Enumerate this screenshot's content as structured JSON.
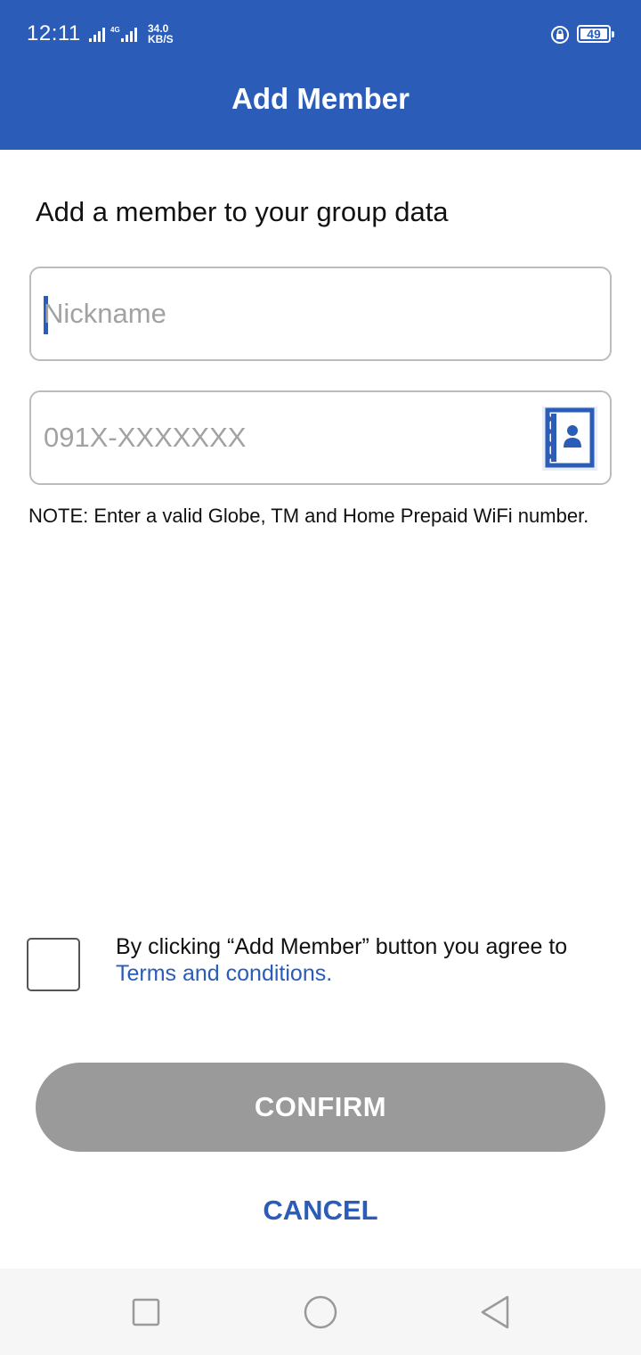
{
  "status_bar": {
    "time": "12:11",
    "network": "4G",
    "speed_value": "34.0",
    "speed_unit": "KB/S",
    "battery": "49"
  },
  "header": {
    "title": "Add Member",
    "background_color": "#2a5cb8"
  },
  "subtitle": "Add a member to your group data",
  "nickname_field": {
    "placeholder": "Nickname",
    "value": ""
  },
  "phone_field": {
    "placeholder": "091X-XXXXXXX",
    "value": "",
    "icon": "contacts-book-icon"
  },
  "note": "NOTE: Enter a valid Globe, TM and Home Prepaid WiFi number.",
  "agreement": {
    "checked": false,
    "text": "By clicking “Add Member” button you agree to ",
    "link_text": "Terms and conditions."
  },
  "buttons": {
    "confirm": "CONFIRM",
    "cancel": "CANCEL"
  },
  "colors": {
    "accent": "#2a5cb8",
    "confirm_disabled": "#9a9a9a"
  },
  "nav_bar": {
    "items": [
      "recent-apps-icon",
      "home-icon",
      "back-icon"
    ]
  }
}
